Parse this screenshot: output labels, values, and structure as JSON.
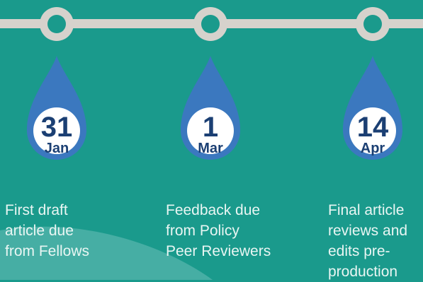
{
  "colors": {
    "background": "#1a9a8c",
    "timeline": "#d6d2cc",
    "drop": "#3b78bf",
    "badge": "#ffffff",
    "date_text": "#1b3f73",
    "label_text": "#e9f6f3",
    "swoosh": "#6cc0b8"
  },
  "milestones": [
    {
      "day": "31",
      "month": "Jan",
      "label": "First draft\narticle due\nfrom Fellows"
    },
    {
      "day": "1",
      "month": "Mar",
      "label": "Feedback due\nfrom Policy\nPeer Reviewers"
    },
    {
      "day": "14",
      "month": "Apr",
      "label": "Final article\nreviews and\nedits pre-\nproduction"
    }
  ]
}
